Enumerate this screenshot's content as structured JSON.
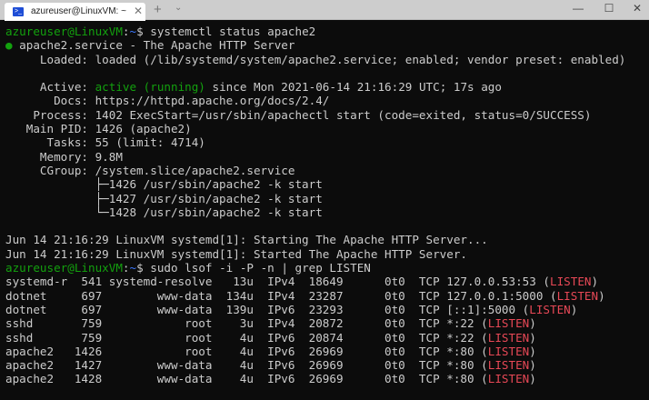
{
  "window": {
    "tab_title": "azureuser@LinuxVM: ~",
    "tab_icon": "terminal-icon",
    "tab_close": "✕",
    "new_tab": "+",
    "dropdown": "⌄",
    "minimize": "—",
    "maximize": "☐",
    "close": "✕"
  },
  "colors": {
    "g": "#13a10e",
    "b": "#3b78ff",
    "w": "#cccccc",
    "r": "#e74856"
  },
  "lines": [
    [
      [
        "azureuser@LinuxVM",
        "g"
      ],
      [
        ":",
        "w"
      ],
      [
        "~",
        "b"
      ],
      [
        "$ systemctl status apache2",
        "w"
      ]
    ],
    [
      [
        "●",
        "g"
      ],
      [
        " apache2.service - The Apache HTTP Server",
        "w"
      ]
    ],
    [
      [
        "     Loaded: loaded (/lib/systemd/system/apache2.service; enabled; vendor preset: enabled)",
        "w"
      ]
    ],
    [],
    [
      [
        "     Active: ",
        "w"
      ],
      [
        "active (running)",
        "g"
      ],
      [
        " since Mon 2021-06-14 21:16:29 UTC; 17s ago",
        "w"
      ]
    ],
    [
      [
        "       Docs: https://httpd.apache.org/docs/2.4/",
        "w"
      ]
    ],
    [
      [
        "    Process: 1402 ExecStart=/usr/sbin/apachectl start (code=exited, status=0/SUCCESS)",
        "w"
      ]
    ],
    [
      [
        "   Main PID: 1426 (apache2)",
        "w"
      ]
    ],
    [
      [
        "      Tasks: 55 (limit: 4714)",
        "w"
      ]
    ],
    [
      [
        "     Memory: 9.8M",
        "w"
      ]
    ],
    [
      [
        "     CGroup: /system.slice/apache2.service",
        "w"
      ]
    ],
    [
      [
        "             ├─1426 /usr/sbin/apache2 -k start",
        "w"
      ]
    ],
    [
      [
        "             ├─1427 /usr/sbin/apache2 -k start",
        "w"
      ]
    ],
    [
      [
        "             └─1428 /usr/sbin/apache2 -k start",
        "w"
      ]
    ],
    [],
    [
      [
        "Jun 14 21:16:29 LinuxVM systemd[1]: Starting The Apache HTTP Server...",
        "w"
      ]
    ],
    [
      [
        "Jun 14 21:16:29 LinuxVM systemd[1]: Started The Apache HTTP Server.",
        "w"
      ]
    ],
    [
      [
        "azureuser@LinuxVM",
        "g"
      ],
      [
        ":",
        "w"
      ],
      [
        "~",
        "b"
      ],
      [
        "$ sudo lsof -i -P -n | grep LISTEN",
        "w"
      ]
    ],
    [
      [
        "systemd-r  541 systemd-resolve   13u  IPv4  18649      0t0  TCP 127.0.0.53:53 (",
        "w"
      ],
      [
        "LISTEN",
        "r"
      ],
      [
        ")",
        "w"
      ]
    ],
    [
      [
        "dotnet     697        www-data  134u  IPv4  23287      0t0  TCP 127.0.0.1:5000 (",
        "w"
      ],
      [
        "LISTEN",
        "r"
      ],
      [
        ")",
        "w"
      ]
    ],
    [
      [
        "dotnet     697        www-data  139u  IPv6  23293      0t0  TCP [::1]:5000 (",
        "w"
      ],
      [
        "LISTEN",
        "r"
      ],
      [
        ")",
        "w"
      ]
    ],
    [
      [
        "sshd       759            root    3u  IPv4  20872      0t0  TCP *:22 (",
        "w"
      ],
      [
        "LISTEN",
        "r"
      ],
      [
        ")",
        "w"
      ]
    ],
    [
      [
        "sshd       759            root    4u  IPv6  20874      0t0  TCP *:22 (",
        "w"
      ],
      [
        "LISTEN",
        "r"
      ],
      [
        ")",
        "w"
      ]
    ],
    [
      [
        "apache2   1426            root    4u  IPv6  26969      0t0  TCP *:80 (",
        "w"
      ],
      [
        "LISTEN",
        "r"
      ],
      [
        ")",
        "w"
      ]
    ],
    [
      [
        "apache2   1427        www-data    4u  IPv6  26969      0t0  TCP *:80 (",
        "w"
      ],
      [
        "LISTEN",
        "r"
      ],
      [
        ")",
        "w"
      ]
    ],
    [
      [
        "apache2   1428        www-data    4u  IPv6  26969      0t0  TCP *:80 (",
        "w"
      ],
      [
        "LISTEN",
        "r"
      ],
      [
        ")",
        "w"
      ]
    ]
  ]
}
